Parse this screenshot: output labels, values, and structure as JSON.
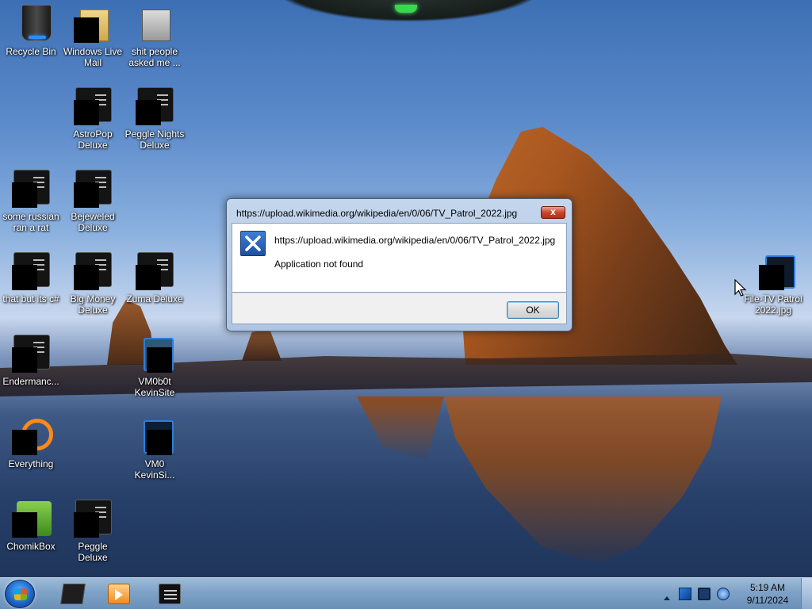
{
  "desktop": {
    "icons": [
      {
        "label": "Recycle Bin"
      },
      {
        "label": "Windows Live Mail"
      },
      {
        "label": "shit people asked me ..."
      },
      {
        "label": "AstroPop Deluxe"
      },
      {
        "label": "Peggle Nights Deluxe"
      },
      {
        "label": "some russian ran a rat"
      },
      {
        "label": "Bejeweled Deluxe"
      },
      {
        "label": "that but its c#"
      },
      {
        "label": "Big Money Deluxe"
      },
      {
        "label": "Zuma Deluxe"
      },
      {
        "label": "Endermanc..."
      },
      {
        "label": "VM0b0t KevinSite"
      },
      {
        "label": "Everything"
      },
      {
        "label": "VM0 KevinSi..."
      },
      {
        "label": "ChomikBox"
      },
      {
        "label": "Peggle Deluxe"
      },
      {
        "label": "File-TV Patrol 2022.jpg"
      }
    ]
  },
  "dialog": {
    "title": "https://upload.wikimedia.org/wikipedia/en/0/06/TV_Patrol_2022.jpg",
    "message_url": "https://upload.wikimedia.org/wikipedia/en/0/06/TV_Patrol_2022.jpg",
    "message": "Application not found",
    "ok_label": "OK",
    "close_symbol": "x",
    "icon": "error-x-icon"
  },
  "taskbar": {
    "pinned": [
      {
        "name": "explorer",
        "icon": "folder-icon"
      },
      {
        "name": "media-player",
        "icon": "media-player-icon"
      },
      {
        "name": "application",
        "icon": "app-window-icon"
      }
    ],
    "tray": {
      "time": "5:19 AM",
      "date": "9/11/2024",
      "icons": [
        "action-center-icon",
        "monitor-icon",
        "network-icon"
      ]
    }
  },
  "colors": {
    "taskbar": "#7ea2c7",
    "dialog_frame": "#aec6e3",
    "close_button": "#c8452c"
  }
}
